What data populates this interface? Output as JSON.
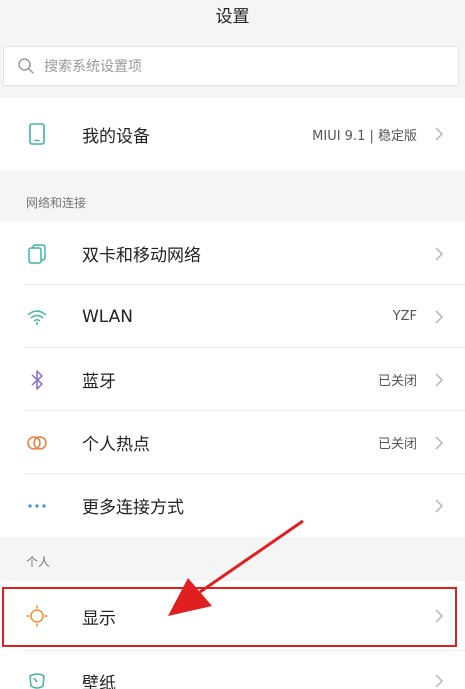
{
  "header": {
    "title": "设置"
  },
  "search": {
    "placeholder": "搜索系统设置项",
    "icon": "search-icon"
  },
  "my_device": {
    "label": "我的设备",
    "value": "MIUI 9.1 | 稳定版",
    "icon": "phone-icon"
  },
  "sections": {
    "network": {
      "title": "网络和连接",
      "items": [
        {
          "label": "双卡和移动网络",
          "value": "",
          "icon": "sim-cards-icon"
        },
        {
          "label": "WLAN",
          "value": "YZF",
          "icon": "wifi-icon"
        },
        {
          "label": "蓝牙",
          "value": "已关闭",
          "icon": "bluetooth-icon"
        },
        {
          "label": "个人热点",
          "value": "已关闭",
          "icon": "hotspot-icon"
        },
        {
          "label": "更多连接方式",
          "value": "",
          "icon": "more-dots-icon"
        }
      ]
    },
    "personal": {
      "title": "个人",
      "items": [
        {
          "label": "显示",
          "value": "",
          "icon": "display-sun-icon"
        },
        {
          "label": "壁纸",
          "value": "",
          "icon": "wallpaper-icon"
        }
      ]
    }
  },
  "colors": {
    "accent_teal": "#3fb6a8",
    "highlight_red": "#e02020",
    "bluetooth_purple": "#8a6ad0",
    "hotspot_orange": "#f07a3a",
    "display_orange": "#f0902a"
  }
}
